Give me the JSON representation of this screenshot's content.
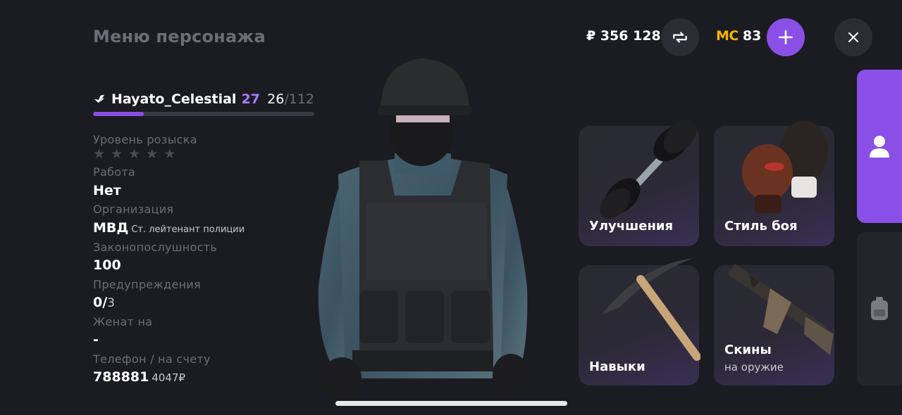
{
  "header": {
    "title": "Меню персонажа",
    "balance": "₽ 356 128",
    "mc_label": "MC",
    "mc_value": "83",
    "icons": {
      "refresh": "refresh-icon",
      "add": "plus-icon",
      "close": "close-icon"
    }
  },
  "player": {
    "name": "Hayato_Celestial",
    "level": "27",
    "xp_current": "26",
    "xp_max": "/112",
    "xp_progress": 0.23
  },
  "stats": {
    "wanted_label": "Уровень розыска",
    "wanted_stars": 5,
    "wanted_level": 0,
    "job_label": "Работа",
    "job_value": "Нет",
    "org_label": "Организация",
    "org_value": "МВД",
    "org_rank": "Ст. лейтенант полиции",
    "law_label": "Законопослушность",
    "law_value": "100",
    "warnings_label": "Предупреждения",
    "warnings_value": "0/",
    "warnings_max": "3",
    "married_label": "Женат на",
    "married_value": "-",
    "phone_label": "Телефон / на счету",
    "phone_value": "788881",
    "phone_balance": "4047₽"
  },
  "cards": {
    "upgrades": "Улучшения",
    "fight_style": "Стиль боя",
    "skills": "Навыки",
    "skins": "Скины",
    "skins_sub": "на оружие"
  },
  "colors": {
    "accent": "#8a4fe6",
    "level": "#a97bff",
    "mc": "#f2b600",
    "background": "#1b1b22"
  },
  "side_tabs": [
    "profile-icon",
    "backpack-icon"
  ]
}
